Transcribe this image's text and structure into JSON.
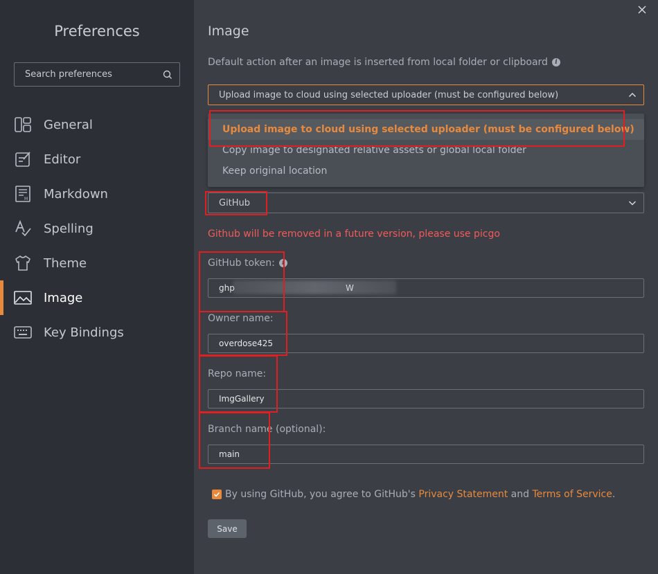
{
  "sidebar": {
    "title": "Preferences",
    "search_placeholder": "Search preferences",
    "items": [
      {
        "label": "General",
        "icon": "general-icon"
      },
      {
        "label": "Editor",
        "icon": "editor-icon"
      },
      {
        "label": "Markdown",
        "icon": "markdown-icon"
      },
      {
        "label": "Spelling",
        "icon": "spelling-icon"
      },
      {
        "label": "Theme",
        "icon": "theme-icon"
      },
      {
        "label": "Image",
        "icon": "image-icon",
        "active": true
      },
      {
        "label": "Key Bindings",
        "icon": "keyboard-icon"
      }
    ]
  },
  "main": {
    "title": "Image",
    "default_action_label": "Default action after an image is inserted from local folder or clipboard",
    "default_action_selected": "Upload image to cloud using selected uploader (must be configured below)",
    "default_action_options": [
      "Upload image to cloud using selected uploader (must be configured below)",
      "Copy image to designated relative assets or global local folder",
      "Keep original location"
    ],
    "uploader_selected": "GitHub",
    "warning": "Github will be removed in a future version, please use picgo",
    "token_label": "GitHub token:",
    "token_value": "ghp                                          W",
    "owner_label": "Owner name:",
    "owner_value": "overdose425",
    "repo_label": "Repo name:",
    "repo_value": "ImgGallery",
    "branch_label": "Branch name (optional):",
    "branch_value": "main",
    "agree_prefix": "By using GitHub, you agree to GitHub's",
    "privacy_link": "Privacy Statement",
    "agree_and": "and",
    "terms_link": "Terms of Service",
    "agree_suffix": ".",
    "agree_checked": true,
    "save_label": "Save"
  },
  "colors": {
    "accent": "#e88a3d",
    "warning": "#f15b5b",
    "annotation": "#e02020"
  }
}
